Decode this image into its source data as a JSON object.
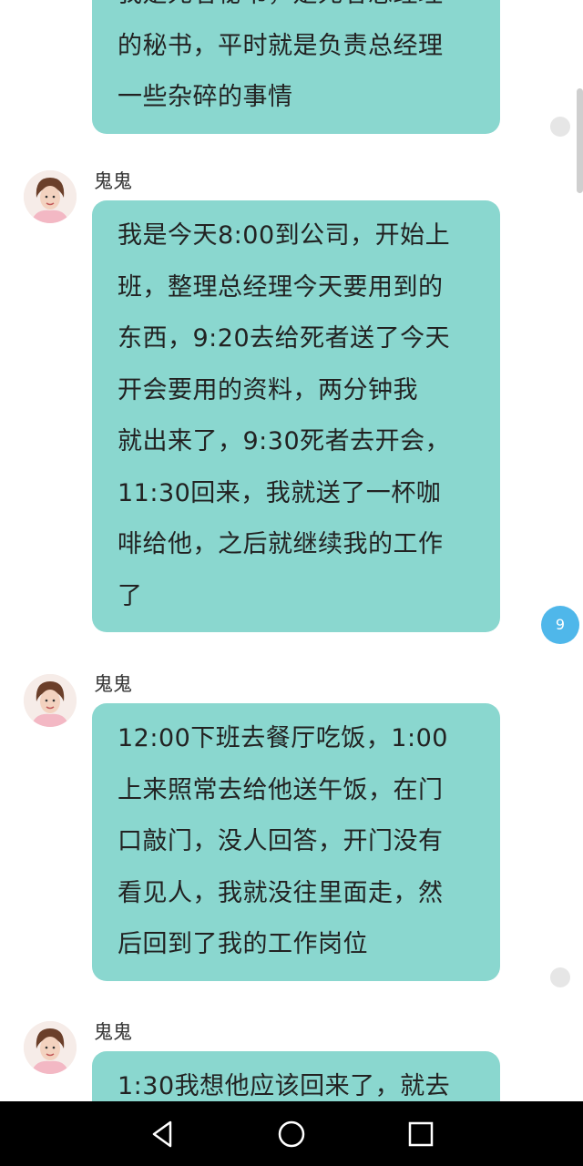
{
  "messages": [
    {
      "sender": "",
      "lines": [
        "我是死者秘书，是死者总经理",
        "的秘书，平时就是负责总经理",
        "一些杂碎的事情"
      ]
    },
    {
      "sender": "鬼鬼",
      "lines": [
        "我是今天8:00到公司，开始上",
        "班，整理总经理今天要用到的",
        "东西，9:20去给死者送了今天",
        "开会要用的资料，两分钟我",
        "就出来了，9:30死者去开会，",
        "11:30回来，我就送了一杯咖",
        "啡给他，之后就继续我的工作",
        "了"
      ]
    },
    {
      "sender": "鬼鬼",
      "lines": [
        "12:00下班去餐厅吃饭，1:00",
        "上来照常去给他送午饭，在门",
        "口敲门，没人回答，开门没有",
        "看见人，我就没往里面走，然",
        "后回到了我的工作岗位"
      ]
    },
    {
      "sender": "鬼鬼",
      "lines": [
        "1:30我想他应该回来了，就去"
      ]
    }
  ],
  "badge": {
    "count": "9"
  },
  "colors": {
    "bubble": "#8ad7cf",
    "badge": "#4fb7ea",
    "navbar": "#000000"
  },
  "navbar": {
    "buttons": [
      "back-icon",
      "home-icon",
      "recents-icon"
    ]
  }
}
